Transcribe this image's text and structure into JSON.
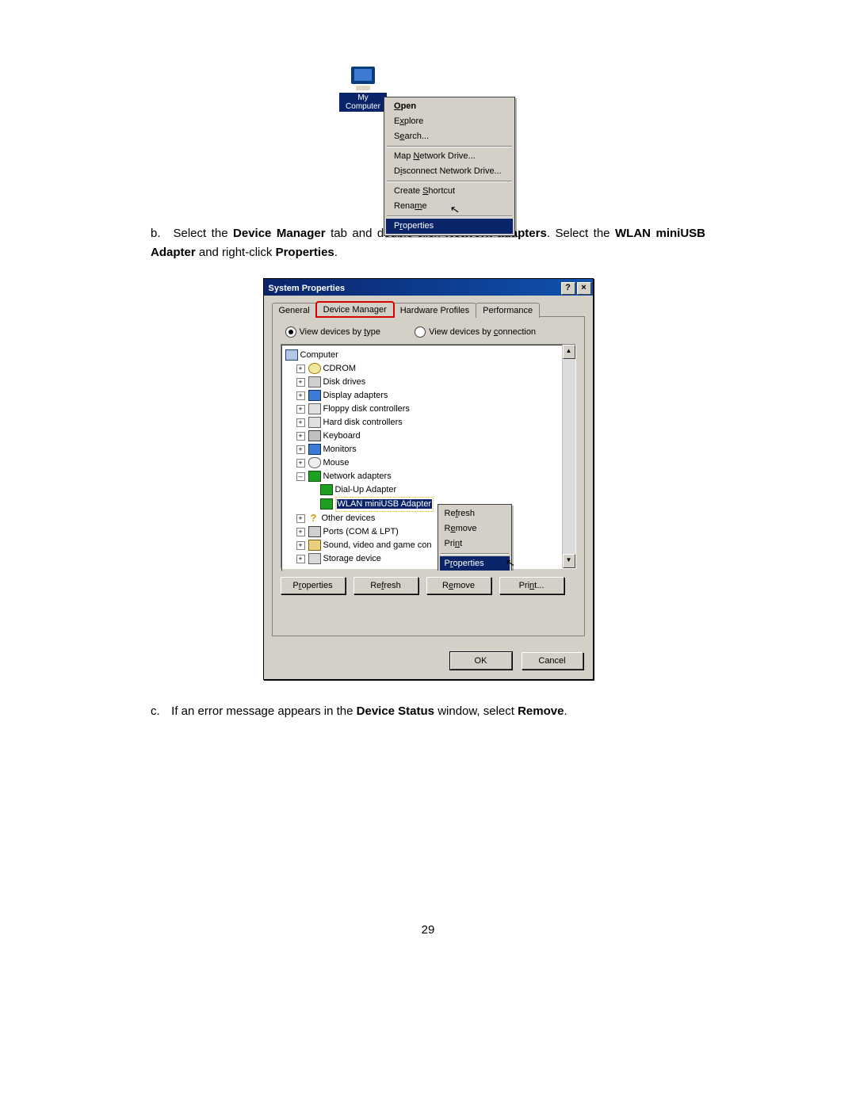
{
  "fig1": {
    "icon_label": "My Computer",
    "menu": {
      "open": "Open",
      "explore": "Explore",
      "search": "Search...",
      "map": "Map Network Drive...",
      "disconnect": "Disconnect Network Drive...",
      "shortcut": "Create Shortcut",
      "rename": "Rename",
      "properties": "Properties"
    }
  },
  "step_b": {
    "prefix": "b.",
    "t1": "Select the ",
    "b1": "Device Manager",
    "t2": " tab and double-click ",
    "b2": "Network adapters",
    "t3": ". Select the ",
    "b3": "WLAN miniUSB Adapter",
    "t4": " and right-click ",
    "b4": "Properties",
    "t5": "."
  },
  "fig2": {
    "title": "System Properties",
    "tabs": {
      "general": "General",
      "device_manager": "Device Manager",
      "hardware": "Hardware Profiles",
      "performance": "Performance"
    },
    "radio_type": "View devices by type",
    "radio_conn": "View devices by connection",
    "tree": {
      "computer": "Computer",
      "cdrom": "CDROM",
      "disk": "Disk drives",
      "display": "Display adapters",
      "floppy": "Floppy disk controllers",
      "hdd": "Hard disk controllers",
      "keyboard": "Keyboard",
      "monitors": "Monitors",
      "mouse": "Mouse",
      "network": "Network adapters",
      "dialup": "Dial-Up Adapter",
      "wlan": "WLAN miniUSB Adapter",
      "other": "Other devices",
      "ports": "Ports (COM & LPT)",
      "sound": "Sound, video and game con",
      "storage": "Storage device"
    },
    "ctx": {
      "refresh": "Refresh",
      "remove": "Remove",
      "print": "Print",
      "properties": "Properties"
    },
    "buttons": {
      "properties": "Properties",
      "refresh": "Refresh",
      "remove": "Remove",
      "print": "Print...",
      "ok": "OK",
      "cancel": "Cancel"
    }
  },
  "step_c": {
    "prefix": "c.",
    "t1": "If an error message appears in the ",
    "b1": "Device Status",
    "t2": " window, select ",
    "b2": "Remove",
    "t3": "."
  },
  "page_number": "29"
}
